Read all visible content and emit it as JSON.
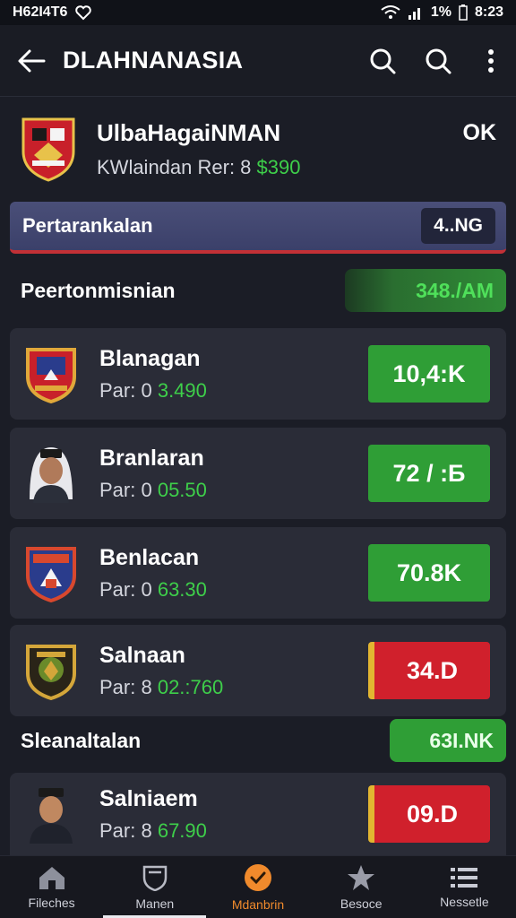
{
  "status_bar": {
    "carrier": "H62I4T6",
    "battery": "1%",
    "time": "8:23"
  },
  "app_bar": {
    "title": "DLAHNANASIA"
  },
  "team": {
    "name": "UlbaHagaiNMAN",
    "sub_prefix": "KWlaindan Rer: 8",
    "sub_value": "$390",
    "ok_label": "OK"
  },
  "banner": {
    "label": "Pertarankalan",
    "value": "4..NG"
  },
  "sections": [
    {
      "label": "Peertonmisnian",
      "value": "348./AM"
    },
    {
      "label": "Sleanaltalan",
      "value": "63I.NK"
    }
  ],
  "players": [
    {
      "name": "Blanagan",
      "sub_prefix": "Par: 0",
      "sub_value": "3.490",
      "badge": "10,4:K",
      "badge_color": "green"
    },
    {
      "name": "Branlaran",
      "sub_prefix": "Par: 0",
      "sub_value": "05.50",
      "badge": "72 / :Б",
      "badge_color": "green"
    },
    {
      "name": "Benlacan",
      "sub_prefix": "Par: 0",
      "sub_value": "63.30",
      "badge": "70.8K",
      "badge_color": "green"
    },
    {
      "name": "Salnaan",
      "sub_prefix": "Par: 8",
      "sub_value": "02.:760",
      "badge": "34.D",
      "badge_color": "red"
    },
    {
      "name": "Salniaem",
      "sub_prefix": "Par: 8",
      "sub_value": "67.90",
      "badge": "09.D",
      "badge_color": "red"
    }
  ],
  "bottom_nav": [
    {
      "label": "Fileches",
      "icon": "home-icon"
    },
    {
      "label": "Manen",
      "icon": "shield-icon"
    },
    {
      "label": "Mdanbrin",
      "icon": "check-circle-icon"
    },
    {
      "label": "Besoce",
      "icon": "star-icon"
    },
    {
      "label": "Nessetle",
      "icon": "list-icon"
    }
  ],
  "colors": {
    "accent_green": "#3ecf4a",
    "badge_green": "#2f9e36",
    "badge_red": "#d0202c",
    "active_nav": "#f08a2c"
  }
}
